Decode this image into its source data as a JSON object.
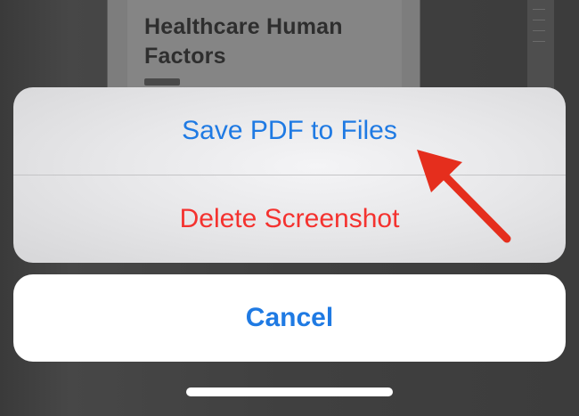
{
  "background": {
    "document_heading": "Healthcare Human Factors"
  },
  "action_sheet": {
    "save_label": "Save PDF to Files",
    "delete_label": "Delete Screenshot",
    "cancel_label": "Cancel"
  },
  "colors": {
    "accent": "#1f7ae3",
    "destructive": "#f4322f",
    "annotation": "#e52e1d"
  }
}
